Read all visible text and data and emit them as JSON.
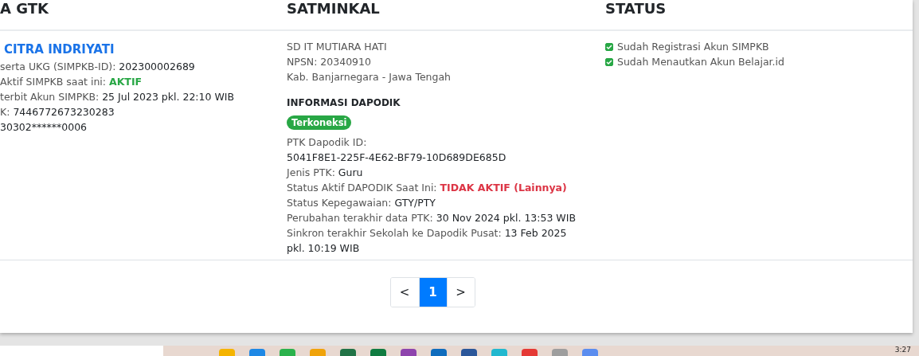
{
  "table": {
    "columns": [
      "A GTK",
      "SATMINKAL",
      "STATUS"
    ],
    "row": {
      "gtk": {
        "name": "CITRA INDRIYATI",
        "lines": [
          {
            "label": "serta UKG (SIMPKB-ID): ",
            "value": "202300002689",
            "kind": "plain"
          },
          {
            "label": " Aktif SIMPKB saat ini: ",
            "value": "AKTIF",
            "kind": "success"
          },
          {
            "label": "terbit Akun SIMPKB: ",
            "value": "25 Jul 2023 pkl. 22:10 WIB",
            "kind": "plain"
          },
          {
            "label": "K: ",
            "value": "7446772673230283",
            "kind": "plain"
          },
          {
            "value": "30302******0006",
            "kind": "plain"
          }
        ]
      },
      "satminkal": {
        "lines": [
          "SD IT MUTIARA HATI",
          "NPSN: 20340910",
          "Kab. Banjarnegara - Jawa Tengah"
        ],
        "dapodik_title": "INFORMASI DAPODIK",
        "badge": "Terkoneksi",
        "lines2": [
          {
            "label": "PTK Dapodik ID:"
          },
          {
            "value": "5041F8E1-225F-4E62-BF79-10D689DE685D",
            "kind": "plain"
          },
          {
            "label": "Jenis PTK: ",
            "value": "Guru",
            "kind": "plain"
          },
          {
            "label": "Status Aktif DAPODIK Saat Ini: ",
            "value": "TIDAK AKTIF (Lainnya)",
            "kind": "danger"
          },
          {
            "label": "Status Kepegawaian: ",
            "value": "GTY/PTY",
            "kind": "plain"
          },
          {
            "label": "Perubahan terakhir data PTK: ",
            "value": "30 Nov 2024 pkl. 13:53 WIB",
            "kind": "plain"
          },
          {
            "label": "Sinkron terakhir Sekolah ke Dapodik Pusat: ",
            "value": "13 Feb 2025 pkl. 10:19 WIB",
            "kind": "plain"
          }
        ]
      },
      "status": [
        {
          "label": "Sudah Registrasi Akun SIMPKB",
          "checked": true
        },
        {
          "label": "Sudah Menautkan Akun Belajar.id",
          "checked": true
        }
      ]
    }
  },
  "pagination": [
    {
      "label": "<",
      "selected": false
    },
    {
      "label": "1",
      "selected": true
    },
    {
      "label": ">",
      "selected": false
    }
  ],
  "taskbar": {
    "time": "3:27"
  }
}
